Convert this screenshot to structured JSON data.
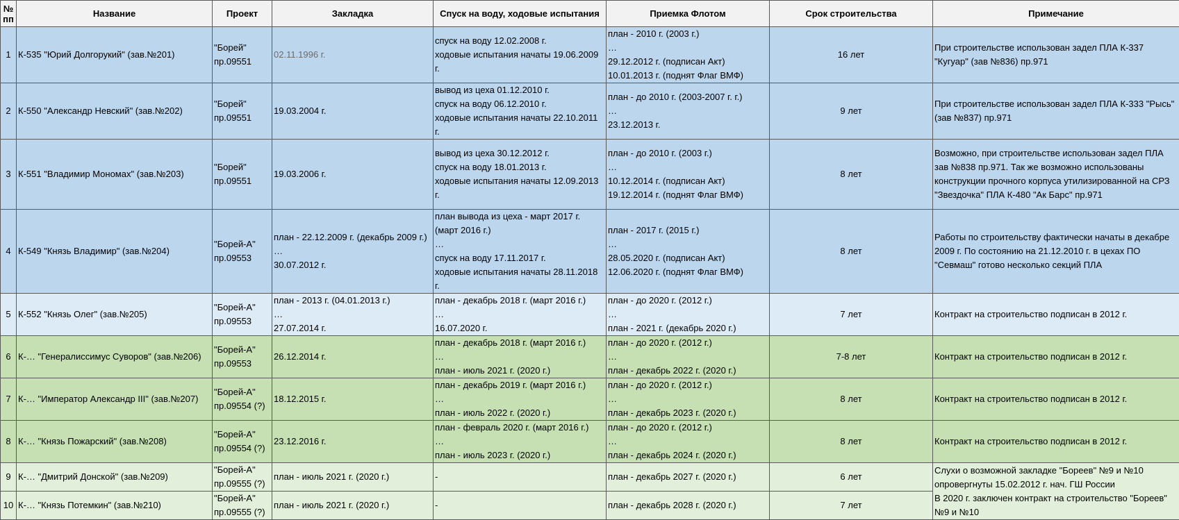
{
  "headers": {
    "num": "№\nпп",
    "name": "Название",
    "project": "Проект",
    "laid": "Закладка",
    "launch": "Спуск на воду, ходовые испытания",
    "accept": "Приемка Флотом",
    "term": "Срок строительства",
    "note": "Примечание"
  },
  "rows": [
    {
      "num": "1",
      "name": "К-535 \"Юрий Долгорукий\" (зав.№201)",
      "project": "\"Борей\"\nпр.09551",
      "laid": "02.11.1996 г.",
      "launch": "спуск на воду 12.02.2008 г.\nходовые испытания начаты 19.06.2009 г.",
      "accept": "план - 2010 г. (2003 г.)\n…\n29.12.2012 г. (подписан Акт)\n10.01.2013 г. (поднят Флаг ВМФ)",
      "term": "16 лет",
      "note": "При строительстве использован задел ПЛА К-337 \"Кугуар\" (зав №836) пр.971"
    },
    {
      "num": "2",
      "name": "К-550 \"Александр Невский\" (зав.№202)",
      "project": "\"Борей\"\nпр.09551",
      "laid": "19.03.2004 г.",
      "launch": "вывод из цеха 01.12.2010 г.\nспуск на воду 06.12.2010 г.\nходовые испытания начаты 22.10.2011 г.",
      "accept": "план - до 2010 г. (2003-2007 г. г.)\n…\n23.12.2013 г.",
      "term": "9 лет",
      "note": "При строительстве использован задел ПЛА К-333 \"Рысь\" (зав №837) пр.971"
    },
    {
      "num": "3",
      "name": "К-551 \"Владимир Мономах\" (зав.№203)",
      "project": "\"Борей\"\nпр.09551",
      "laid": "19.03.2006 г.",
      "launch": "вывод из цеха 30.12.2012 г.\nспуск на воду 18.01.2013 г.\nходовые испытания начаты 12.09.2013 г.",
      "accept": "план - до 2010 г. (2003  г.)\n…\n10.12.2014 г. (подписан Акт)\n19.12.2014 г. (поднят Флаг ВМФ)",
      "term": "8 лет",
      "note": "Возможно, при строительстве использован задел ПЛА зав №838 пр.971. Так же возможно использованы конструкции прочного корпуса утилизированной на СРЗ \"Звездочка\" ПЛА К-480 \"Ак Барс\" пр.971"
    },
    {
      "num": "4",
      "name": "К-549 \"Князь Владимир\" (зав.№204)",
      "project": "\"Борей-А\"\nпр.09553",
      "laid": "план - 22.12.2009 г. (декабрь 2009 г.)\n…\n30.07.2012 г.",
      "launch": "план вывода из цеха - март 2017 г. (март 2016 г.)\n…\nспуск на воду 17.11.2017 г.\nходовые испытания начаты 28.11.2018 г.",
      "accept": "план - 2017 г. (2015 г.)\n…\n28.05.2020 г. (подписан Акт)\n12.06.2020 г. (поднят Флаг ВМФ)",
      "term": "8 лет",
      "note": "Работы по строительству фактически начаты в декабре 2009 г. По состоянию на 21.12.2010 г. в цехах ПО \"Севмаш\" готово несколько секций ПЛА"
    },
    {
      "num": "5",
      "name": "К-552 \"Князь Олег\" (зав.№205)",
      "project": "\"Борей-А\"\nпр.09553",
      "laid": "план - 2013 г. (04.01.2013 г.)\n…\n27.07.2014 г.",
      "launch": "план - декабрь 2018 г. (март 2016 г.)\n…\n16.07.2020 г.",
      "accept": "план - до 2020 г. (2012 г.)\n…\nплан - 2021 г. (декабрь 2020 г.)",
      "term": "7 лет",
      "note": "Контракт на строительство подписан в 2012 г."
    },
    {
      "num": "6",
      "name": "К-… \"Генералиссимус Суворов\" (зав.№206)",
      "project": "\"Борей-А\"\nпр.09553",
      "laid": "26.12.2014 г.",
      "launch": "план - декабрь 2018 г. (март 2016 г.)\n…\nплан - июль 2021 г. (2020 г.)",
      "accept": "план - до 2020 г. (2012 г.)\n…\nплан - декабрь 2022 г. (2020 г.)",
      "term": "7-8 лет",
      "note": "Контракт на строительство подписан в 2012 г."
    },
    {
      "num": "7",
      "name": "К-… \"Император Александр III\" (зав.№207)",
      "project": "\"Борей-А\"\nпр.09554 (?)",
      "laid": "18.12.2015 г.",
      "launch": "план - декабрь 2019 г. (март 2016 г.)\n…\nплан - июль 2022 г. (2020 г.)",
      "accept": "план - до 2020 г. (2012 г.)\n…\nплан - декабрь 2023 г. (2020 г.)",
      "term": "8 лет",
      "note": "Контракт на строительство подписан в 2012 г."
    },
    {
      "num": "8",
      "name": "К-… \"Князь Пожарский\" (зав.№208)",
      "project": "\"Борей-А\"\nпр.09554 (?)",
      "laid": "23.12.2016 г.",
      "launch": "план - февраль 2020 г. (март 2016 г.)\n…\nплан - июль 2023 г. (2020 г.)",
      "accept": "план - до 2020 г. (2012 г.)\n…\nплан - декабрь 2024 г. (2020 г.)",
      "term": "8 лет",
      "note": "Контракт на строительство подписан в 2012 г."
    },
    {
      "num": "9",
      "name": "К-… \"Дмитрий Донской\" (зав.№209)",
      "project": "\"Борей-А\"\nпр.09555 (?)",
      "laid": "план - июль 2021 г. (2020 г.)",
      "launch": "-",
      "accept": "план - декабрь 2027 г. (2020 г.)",
      "term": "6 лет",
      "note": ""
    },
    {
      "num": "10",
      "name": "К-… \"Князь Потемкин\" (зав.№210)",
      "project": "\"Борей-А\"\nпр.09555 (?)",
      "laid": "план - июль 2021 г. (2020 г.)",
      "launch": "-",
      "accept": "план - декабрь 2028 г. (2020 г.)",
      "term": "7 лет",
      "note": ""
    }
  ],
  "merged_note": "Слухи о возможной закладке \"Бореев\" №9 и №10 опровергнуты 15.02.2012 г. нач. ГШ России\nВ 2020 г. заключен контракт на строительство \"Бореев\" №9 и №10",
  "colors": {
    "blue": "#bcd6ee",
    "light_blue": "#ddebf7",
    "green": "#c6e0b4",
    "light_green": "#e2efda",
    "header": "#f2f2f2",
    "grid": "#5a5a5a"
  }
}
